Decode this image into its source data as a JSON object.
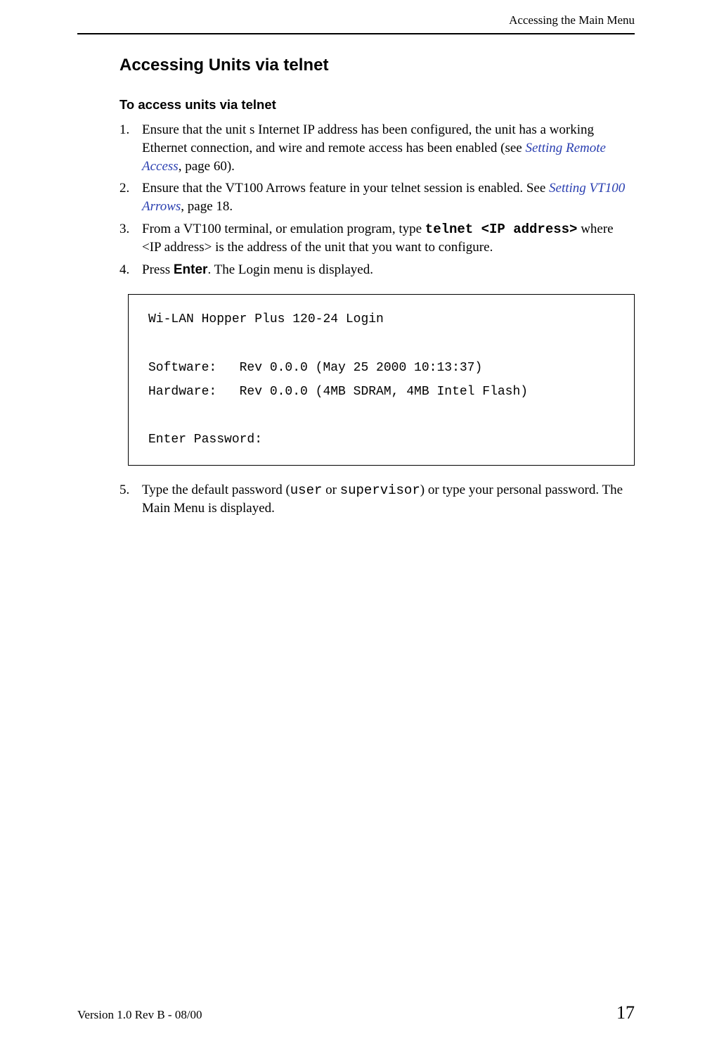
{
  "header": {
    "title": "Accessing the Main Menu"
  },
  "section": {
    "title": "Accessing Units via telnet",
    "subtitle": "To access units via telnet"
  },
  "steps": {
    "s1_a": "Ensure that the unit s Internet IP address has been configured, the unit has a working Ethernet connection, and wire and remote access has been enabled (see ",
    "s1_link": "Setting Remote Access",
    "s1_b": ", page 60).",
    "s2_a": "Ensure that the VT100 Arrows feature in your telnet session is enabled. See ",
    "s2_link": "Setting VT100 Arrows",
    "s2_b": ", page 18.",
    "s3_a": "From a VT100 terminal, or emulation program, type ",
    "s3_cmd": "telnet <IP address>",
    "s3_b": " where <IP address> is the address of the unit that you want to configure.",
    "s4_a": "Press ",
    "s4_key": "Enter",
    "s4_b": ". The Login menu is displayed.",
    "s5_a": "Type the default password (",
    "s5_code1": "user",
    "s5_mid": " or ",
    "s5_code2": "supervisor",
    "s5_b": ") or type your personal password. The Main Menu is displayed."
  },
  "terminal": {
    "line1": "Wi-LAN Hopper Plus 120-24 Login",
    "line2": "Software:   Rev 0.0.0 (May 25 2000 10:13:37)",
    "line3": "Hardware:   Rev 0.0.0 (4MB SDRAM, 4MB Intel Flash)",
    "line4": "Enter Password:"
  },
  "footer": {
    "version": "Version 1.0 Rev B - 08/00",
    "page": "17"
  }
}
